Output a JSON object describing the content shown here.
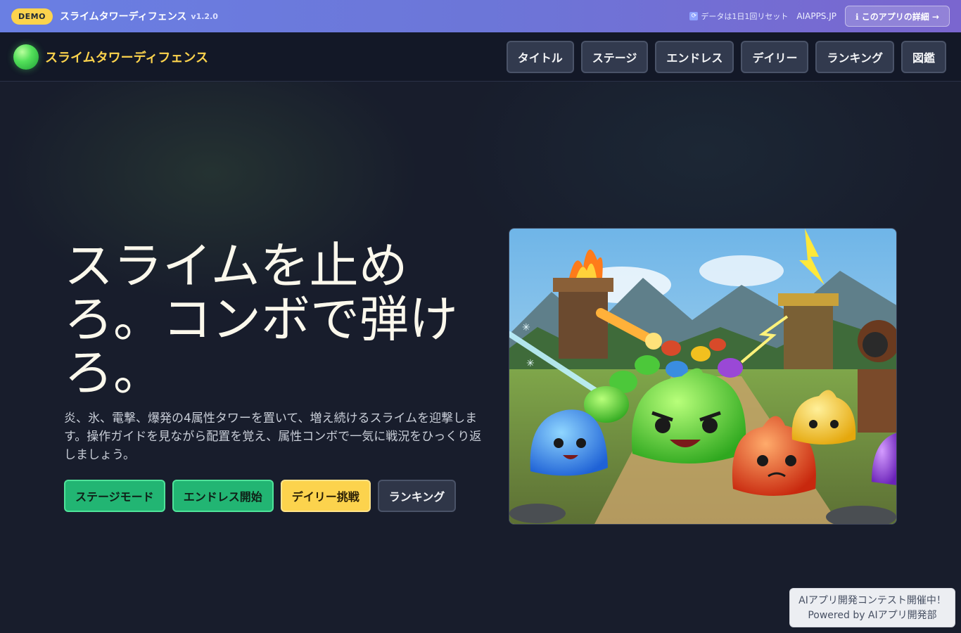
{
  "demo_bar": {
    "badge": "DEMO",
    "title": "スライムタワーディフェンス",
    "version": "v1.2.0",
    "reset_note": "データは1日1回リセット",
    "site": "AIAPPS.JP",
    "detail_button": "ℹ このアプリの詳細 →"
  },
  "header": {
    "logo_text": "スライムタワーディフェンス",
    "nav": [
      "タイトル",
      "ステージ",
      "エンドレス",
      "デイリー",
      "ランキング",
      "図鑑"
    ]
  },
  "hero": {
    "title_line1": "スライムを止め",
    "title_line2": "ろ。コンボで弾け",
    "title_line3": "ろ。",
    "description": "炎、氷、電撃、爆発の4属性タワーを置いて、増え続けるスライムを迎撃します。操作ガイドを見ながら配置を覚え、属性コンボで一気に戦況をひっくり返しましょう。",
    "actions": [
      "ステージモード",
      "エンドレス開始",
      "デイリー挑戦",
      "ランキング"
    ]
  },
  "contest": {
    "line1": "AIアプリ開発コンテスト開催中！",
    "line2": "Powered by AIアプリ開発部"
  },
  "colors": {
    "accent_yellow": "#fcd34d",
    "accent_green": "#22b573",
    "banner_blue": "#6a7fe3"
  }
}
